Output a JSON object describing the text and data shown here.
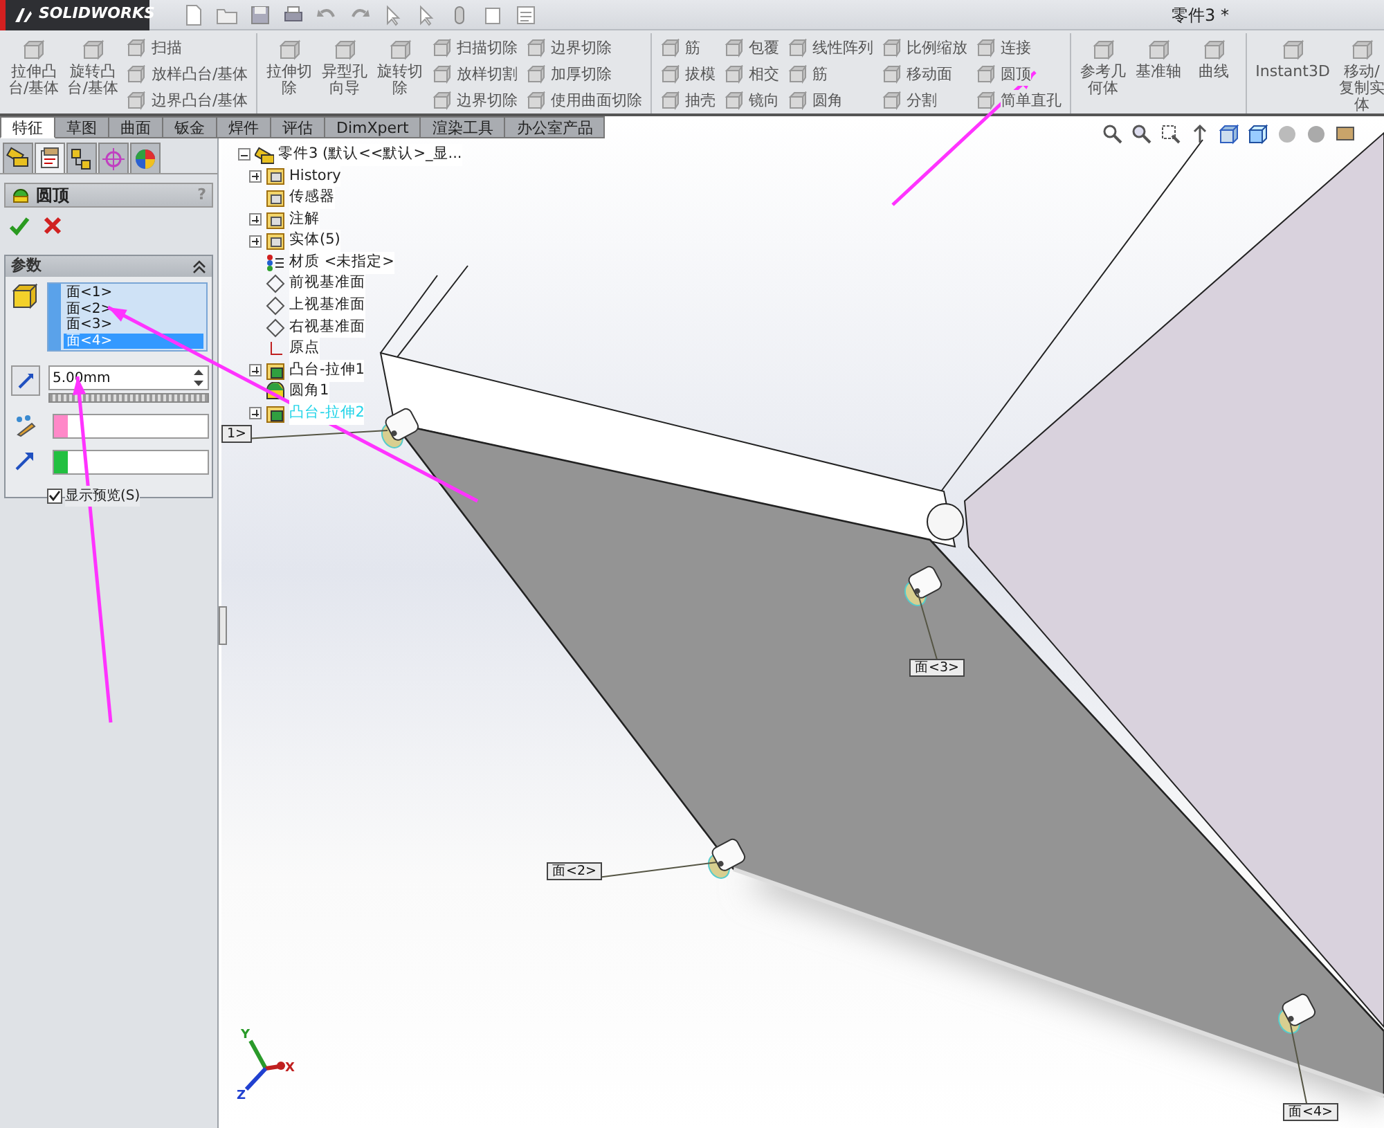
{
  "top_bar": {
    "logo": "SOLIDWORKS",
    "document_title": "零件3 *"
  },
  "ribbon": {
    "groups": [
      {
        "columns": [
          {
            "kind": "large",
            "lines": [
              "拉伸凸",
              "台/基体"
            ]
          },
          {
            "kind": "large",
            "lines": [
              "旋转凸",
              "台/基体"
            ]
          },
          {
            "kind": "stack",
            "items": [
              "扫描",
              "放样凸台/基体",
              "边界凸台/基体"
            ]
          }
        ]
      },
      {
        "columns": [
          {
            "kind": "large",
            "lines": [
              "拉伸切",
              "除"
            ]
          },
          {
            "kind": "large",
            "lines": [
              "异型孔",
              "向导"
            ]
          },
          {
            "kind": "large",
            "lines": [
              "旋转切",
              "除"
            ]
          },
          {
            "kind": "stack",
            "items": [
              "扫描切除",
              "放样切割",
              "边界切除"
            ]
          },
          {
            "kind": "stack",
            "items": [
              "边界切除",
              "加厚切除",
              "使用曲面切除"
            ]
          }
        ]
      },
      {
        "columns": [
          {
            "kind": "stack",
            "items": [
              "筋",
              "拔模",
              "抽壳"
            ]
          },
          {
            "kind": "stack",
            "items": [
              "包覆",
              "相交",
              "镜向"
            ]
          },
          {
            "kind": "stack",
            "items": [
              "线性阵列",
              "筋",
              "圆角"
            ]
          },
          {
            "kind": "stack",
            "items": [
              "比例缩放",
              "移动面",
              "分割"
            ]
          },
          {
            "kind": "stack",
            "items": [
              "连接",
              "圆顶",
              "简单直孔"
            ]
          }
        ]
      },
      {
        "columns": [
          {
            "kind": "large",
            "lines": [
              "参考几",
              "何体"
            ]
          },
          {
            "kind": "large",
            "lines": [
              "基准轴"
            ]
          },
          {
            "kind": "large",
            "lines": [
              "曲线"
            ]
          }
        ]
      },
      {
        "columns": [
          {
            "kind": "large",
            "lines": [
              "Instant3D"
            ]
          },
          {
            "kind": "large",
            "lines": [
              "移动/",
              "复制实",
              "体"
            ]
          }
        ]
      }
    ]
  },
  "command_tabs": [
    {
      "label": "特征",
      "selected": true
    },
    {
      "label": "草图",
      "selected": false
    },
    {
      "label": "曲面",
      "selected": false
    },
    {
      "label": "钣金",
      "selected": false
    },
    {
      "label": "焊件",
      "selected": false
    },
    {
      "label": "评估",
      "selected": false
    },
    {
      "label": "DimXpert",
      "selected": false
    },
    {
      "label": "渲染工具",
      "selected": false
    },
    {
      "label": "办公室产品",
      "selected": false
    }
  ],
  "panel_tabs": [
    {
      "selected": false
    },
    {
      "selected": true
    },
    {
      "selected": false
    },
    {
      "selected": false
    },
    {
      "selected": false
    }
  ],
  "property_manager": {
    "title": "圆顶",
    "help": "?",
    "section_title": "参数",
    "faces": [
      {
        "label": "面<1>",
        "selected": false
      },
      {
        "label": "面<2>",
        "selected": false
      },
      {
        "label": "面<3>",
        "selected": false
      },
      {
        "label": "面<4>",
        "selected": true
      }
    ],
    "distance": {
      "value": "5.00mm"
    },
    "color_rows": [
      {
        "color": "#ff88c8"
      },
      {
        "color": "#22c040"
      }
    ],
    "preview": {
      "label": "显示预览(S)",
      "checked": true
    }
  },
  "feature_tree": {
    "root": {
      "label": "零件3  (默认<<默认>_显...",
      "kind": "part",
      "expanded": true,
      "selected": false,
      "children": [
        {
          "label": "History",
          "kind": "folder",
          "expanded": false,
          "selected": false
        },
        {
          "label": "传感器",
          "kind": "folder",
          "selected": false
        },
        {
          "label": "注解",
          "kind": "folder",
          "expanded": false,
          "selected": false
        },
        {
          "label": "实体(5)",
          "kind": "folder",
          "expanded": false,
          "selected": false
        },
        {
          "label": "材质 <未指定>",
          "kind": "material",
          "selected": false
        },
        {
          "label": "前视基准面",
          "kind": "plane",
          "selected": false
        },
        {
          "label": "上视基准面",
          "kind": "plane",
          "selected": false
        },
        {
          "label": "右视基准面",
          "kind": "plane",
          "selected": false
        },
        {
          "label": "原点",
          "kind": "origin",
          "selected": false
        },
        {
          "label": "凸台-拉伸1",
          "kind": "feature",
          "expanded": false,
          "selected": false
        },
        {
          "label": "圆角1",
          "kind": "fillet",
          "selected": false
        },
        {
          "label": "凸台-拉伸2",
          "kind": "feature",
          "expanded": false,
          "selected": true
        }
      ]
    }
  },
  "callouts": [
    {
      "label": "1>"
    },
    {
      "label": "面<2>"
    },
    {
      "label": "面<3>"
    },
    {
      "label": "面<4>"
    }
  ],
  "triad": {
    "axes": [
      "Y",
      "X",
      "Z"
    ]
  }
}
